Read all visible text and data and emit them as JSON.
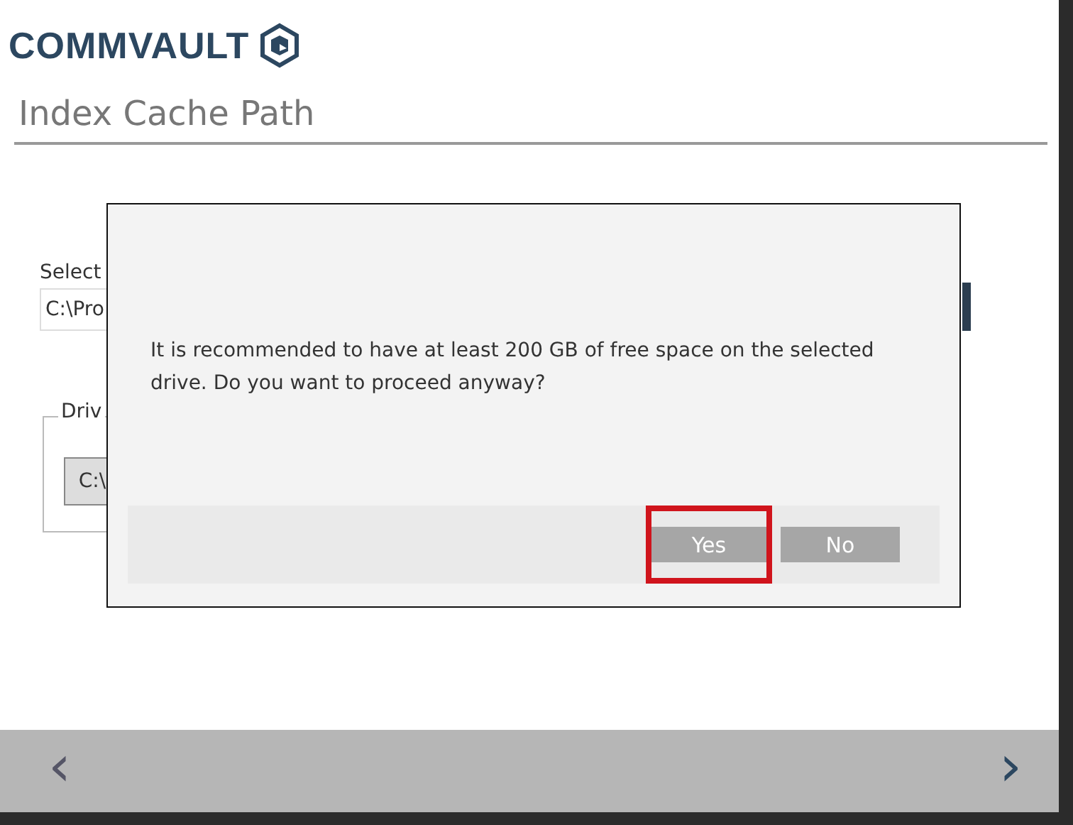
{
  "header": {
    "logo": "COMMVAULT",
    "page_title": "Index Cache Path"
  },
  "background": {
    "select_label": "Select",
    "path_value": "C:\\Pro",
    "drive_group": "Driv",
    "drive_button": "C:\\"
  },
  "dialog": {
    "message": "It is recommended to have at least 200 GB of free space on the selected drive. Do you want to proceed anyway?",
    "buttons": [
      {
        "label": "Yes",
        "highlighted": true
      },
      {
        "label": "No",
        "highlighted": false
      }
    ]
  },
  "footer": {
    "back": "‹",
    "next": "›"
  }
}
